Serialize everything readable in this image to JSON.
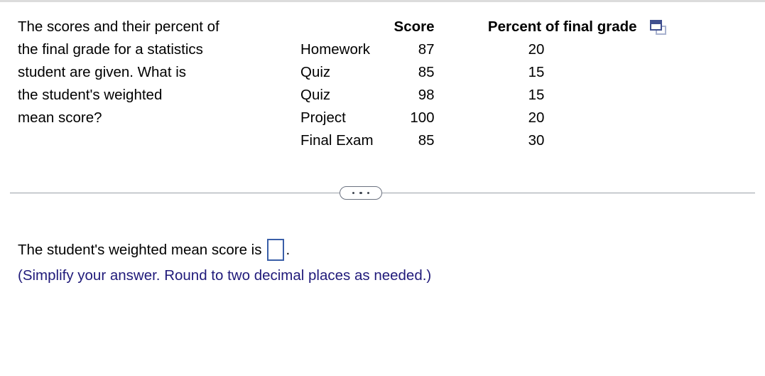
{
  "question": {
    "prompt": "The scores and their percent of\nthe final grade for a statistics\nstudent are given. What is\nthe student's weighted\nmean score?"
  },
  "table": {
    "headers": {
      "label": "",
      "score": "Score",
      "percent": "Percent of final grade"
    },
    "rows": [
      {
        "label": "Homework",
        "score": "87",
        "percent": "20"
      },
      {
        "label": "Quiz",
        "score": "85",
        "percent": "15"
      },
      {
        "label": "Quiz",
        "score": "98",
        "percent": "15"
      },
      {
        "label": "Project",
        "score": "100",
        "percent": "20"
      },
      {
        "label": "Final Exam",
        "score": "85",
        "percent": "30"
      }
    ],
    "popout_icon": "popout-window-icon"
  },
  "divider": {
    "more_button_icon": "ellipsis-icon"
  },
  "answer": {
    "text_before": "The student's weighted mean score is",
    "text_after": ".",
    "input_value": "",
    "input_placeholder": "",
    "hint": "(Simplify your answer. Round to two decimal places as needed.)"
  },
  "colors": {
    "hint_blue": "#201a7a",
    "input_border_blue": "#3a5fa8",
    "divider_gray": "#9aa0a8",
    "icon_navy": "#3f4f8f",
    "icon_light": "#a8b2cf"
  }
}
